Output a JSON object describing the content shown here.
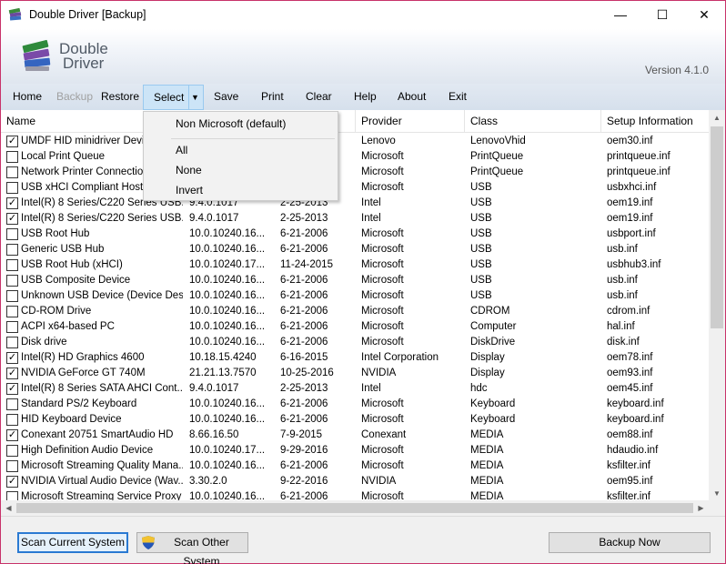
{
  "window": {
    "title": "Double Driver [Backup]",
    "controls": {
      "minimize": "—",
      "maximize": "☐",
      "close": "✕"
    }
  },
  "header": {
    "logo_line1": "Double",
    "logo_line2": "Driver",
    "version": "Version 4.1.0"
  },
  "menu": {
    "home": "Home",
    "backup": "Backup",
    "restore": "Restore",
    "select": "Select",
    "save": "Save",
    "print": "Print",
    "clear": "Clear",
    "help": "Help",
    "about": "About",
    "exit": "Exit"
  },
  "dropdown": {
    "items": [
      "Non Microsoft (default)",
      "All",
      "None",
      "Invert"
    ]
  },
  "table": {
    "columns": {
      "name": "Name",
      "provider": "Provider",
      "class": "Class",
      "inf": "Setup Information"
    },
    "rows": [
      {
        "checked": true,
        "name": "UMDF HID minidriver Device",
        "version": "",
        "date": "",
        "provider": "Lenovo",
        "class": "LenovoVhid",
        "inf": "oem30.inf"
      },
      {
        "checked": false,
        "name": "Local Print Queue",
        "version": "",
        "date": "",
        "provider": "Microsoft",
        "class": "PrintQueue",
        "inf": "printqueue.inf"
      },
      {
        "checked": false,
        "name": "Network Printer Connection",
        "version": "",
        "date": "",
        "provider": "Microsoft",
        "class": "PrintQueue",
        "inf": "printqueue.inf"
      },
      {
        "checked": false,
        "name": "USB xHCI Compliant Host Co...",
        "version": "",
        "date": "",
        "provider": "Microsoft",
        "class": "USB",
        "inf": "usbxhci.inf"
      },
      {
        "checked": true,
        "name": "Intel(R) 8 Series/C220 Series USB...",
        "version": "9.4.0.1017",
        "date": "2-25-2013",
        "provider": "Intel",
        "class": "USB",
        "inf": "oem19.inf"
      },
      {
        "checked": true,
        "name": "Intel(R) 8 Series/C220 Series USB...",
        "version": "9.4.0.1017",
        "date": "2-25-2013",
        "provider": "Intel",
        "class": "USB",
        "inf": "oem19.inf"
      },
      {
        "checked": false,
        "name": "USB Root Hub",
        "version": "10.0.10240.16...",
        "date": "6-21-2006",
        "provider": "Microsoft",
        "class": "USB",
        "inf": "usbport.inf"
      },
      {
        "checked": false,
        "name": "Generic USB Hub",
        "version": "10.0.10240.16...",
        "date": "6-21-2006",
        "provider": "Microsoft",
        "class": "USB",
        "inf": "usb.inf"
      },
      {
        "checked": false,
        "name": "USB Root Hub (xHCI)",
        "version": "10.0.10240.17...",
        "date": "11-24-2015",
        "provider": "Microsoft",
        "class": "USB",
        "inf": "usbhub3.inf"
      },
      {
        "checked": false,
        "name": "USB Composite Device",
        "version": "10.0.10240.16...",
        "date": "6-21-2006",
        "provider": "Microsoft",
        "class": "USB",
        "inf": "usb.inf"
      },
      {
        "checked": false,
        "name": "Unknown USB Device (Device Des...",
        "version": "10.0.10240.16...",
        "date": "6-21-2006",
        "provider": "Microsoft",
        "class": "USB",
        "inf": "usb.inf"
      },
      {
        "checked": false,
        "name": "CD-ROM Drive",
        "version": "10.0.10240.16...",
        "date": "6-21-2006",
        "provider": "Microsoft",
        "class": "CDROM",
        "inf": "cdrom.inf"
      },
      {
        "checked": false,
        "name": "ACPI x64-based PC",
        "version": "10.0.10240.16...",
        "date": "6-21-2006",
        "provider": "Microsoft",
        "class": "Computer",
        "inf": "hal.inf"
      },
      {
        "checked": false,
        "name": "Disk drive",
        "version": "10.0.10240.16...",
        "date": "6-21-2006",
        "provider": "Microsoft",
        "class": "DiskDrive",
        "inf": "disk.inf"
      },
      {
        "checked": true,
        "name": "Intel(R) HD Graphics 4600",
        "version": "10.18.15.4240",
        "date": "6-16-2015",
        "provider": "Intel Corporation",
        "class": "Display",
        "inf": "oem78.inf"
      },
      {
        "checked": true,
        "name": "NVIDIA GeForce GT 740M",
        "version": "21.21.13.7570",
        "date": "10-25-2016",
        "provider": "NVIDIA",
        "class": "Display",
        "inf": "oem93.inf"
      },
      {
        "checked": true,
        "name": "Intel(R) 8 Series SATA AHCI Cont...",
        "version": "9.4.0.1017",
        "date": "2-25-2013",
        "provider": "Intel",
        "class": "hdc",
        "inf": "oem45.inf"
      },
      {
        "checked": false,
        "name": "Standard PS/2 Keyboard",
        "version": "10.0.10240.16...",
        "date": "6-21-2006",
        "provider": "Microsoft",
        "class": "Keyboard",
        "inf": "keyboard.inf"
      },
      {
        "checked": false,
        "name": "HID Keyboard Device",
        "version": "10.0.10240.16...",
        "date": "6-21-2006",
        "provider": "Microsoft",
        "class": "Keyboard",
        "inf": "keyboard.inf"
      },
      {
        "checked": true,
        "name": "Conexant 20751 SmartAudio HD",
        "version": "8.66.16.50",
        "date": "7-9-2015",
        "provider": "Conexant",
        "class": "MEDIA",
        "inf": "oem88.inf"
      },
      {
        "checked": false,
        "name": "High Definition Audio Device",
        "version": "10.0.10240.17...",
        "date": "9-29-2016",
        "provider": "Microsoft",
        "class": "MEDIA",
        "inf": "hdaudio.inf"
      },
      {
        "checked": false,
        "name": "Microsoft Streaming Quality Mana...",
        "version": "10.0.10240.16...",
        "date": "6-21-2006",
        "provider": "Microsoft",
        "class": "MEDIA",
        "inf": "ksfilter.inf"
      },
      {
        "checked": true,
        "name": "NVIDIA Virtual Audio Device (Wav...",
        "version": "3.30.2.0",
        "date": "9-22-2016",
        "provider": "NVIDIA",
        "class": "MEDIA",
        "inf": "oem95.inf"
      },
      {
        "checked": false,
        "name": "Microsoft Streaming Service Proxy",
        "version": "10.0.10240.16...",
        "date": "6-21-2006",
        "provider": "Microsoft",
        "class": "MEDIA",
        "inf": "ksfilter.inf"
      }
    ]
  },
  "buttons": {
    "scan_current": "Scan Current System",
    "scan_other": "Scan Other System",
    "backup_now": "Backup Now"
  },
  "colors": {
    "accent_border": "#c8336a",
    "select_highlight": "#cce4f7",
    "default_button_border": "#2a7ad2"
  },
  "icons": {
    "app": "double-driver-icon",
    "shield": "uac-shield-icon"
  }
}
